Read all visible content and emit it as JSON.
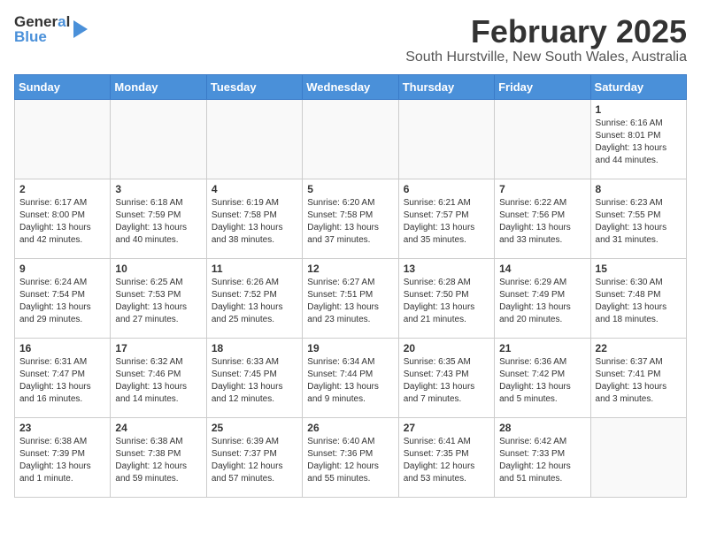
{
  "header": {
    "logo_line1_text": "General",
    "logo_line1_accent": "▶",
    "logo_line2_text": "Blue",
    "month_title": "February 2025",
    "location": "South Hurstville, New South Wales, Australia"
  },
  "calendar": {
    "day_headers": [
      "Sunday",
      "Monday",
      "Tuesday",
      "Wednesday",
      "Thursday",
      "Friday",
      "Saturday"
    ],
    "weeks": [
      {
        "days": [
          {
            "num": "",
            "info": ""
          },
          {
            "num": "",
            "info": ""
          },
          {
            "num": "",
            "info": ""
          },
          {
            "num": "",
            "info": ""
          },
          {
            "num": "",
            "info": ""
          },
          {
            "num": "",
            "info": ""
          },
          {
            "num": "1",
            "info": "Sunrise: 6:16 AM\nSunset: 8:01 PM\nDaylight: 13 hours\nand 44 minutes."
          }
        ]
      },
      {
        "days": [
          {
            "num": "2",
            "info": "Sunrise: 6:17 AM\nSunset: 8:00 PM\nDaylight: 13 hours\nand 42 minutes."
          },
          {
            "num": "3",
            "info": "Sunrise: 6:18 AM\nSunset: 7:59 PM\nDaylight: 13 hours\nand 40 minutes."
          },
          {
            "num": "4",
            "info": "Sunrise: 6:19 AM\nSunset: 7:58 PM\nDaylight: 13 hours\nand 38 minutes."
          },
          {
            "num": "5",
            "info": "Sunrise: 6:20 AM\nSunset: 7:58 PM\nDaylight: 13 hours\nand 37 minutes."
          },
          {
            "num": "6",
            "info": "Sunrise: 6:21 AM\nSunset: 7:57 PM\nDaylight: 13 hours\nand 35 minutes."
          },
          {
            "num": "7",
            "info": "Sunrise: 6:22 AM\nSunset: 7:56 PM\nDaylight: 13 hours\nand 33 minutes."
          },
          {
            "num": "8",
            "info": "Sunrise: 6:23 AM\nSunset: 7:55 PM\nDaylight: 13 hours\nand 31 minutes."
          }
        ]
      },
      {
        "days": [
          {
            "num": "9",
            "info": "Sunrise: 6:24 AM\nSunset: 7:54 PM\nDaylight: 13 hours\nand 29 minutes."
          },
          {
            "num": "10",
            "info": "Sunrise: 6:25 AM\nSunset: 7:53 PM\nDaylight: 13 hours\nand 27 minutes."
          },
          {
            "num": "11",
            "info": "Sunrise: 6:26 AM\nSunset: 7:52 PM\nDaylight: 13 hours\nand 25 minutes."
          },
          {
            "num": "12",
            "info": "Sunrise: 6:27 AM\nSunset: 7:51 PM\nDaylight: 13 hours\nand 23 minutes."
          },
          {
            "num": "13",
            "info": "Sunrise: 6:28 AM\nSunset: 7:50 PM\nDaylight: 13 hours\nand 21 minutes."
          },
          {
            "num": "14",
            "info": "Sunrise: 6:29 AM\nSunset: 7:49 PM\nDaylight: 13 hours\nand 20 minutes."
          },
          {
            "num": "15",
            "info": "Sunrise: 6:30 AM\nSunset: 7:48 PM\nDaylight: 13 hours\nand 18 minutes."
          }
        ]
      },
      {
        "days": [
          {
            "num": "16",
            "info": "Sunrise: 6:31 AM\nSunset: 7:47 PM\nDaylight: 13 hours\nand 16 minutes."
          },
          {
            "num": "17",
            "info": "Sunrise: 6:32 AM\nSunset: 7:46 PM\nDaylight: 13 hours\nand 14 minutes."
          },
          {
            "num": "18",
            "info": "Sunrise: 6:33 AM\nSunset: 7:45 PM\nDaylight: 13 hours\nand 12 minutes."
          },
          {
            "num": "19",
            "info": "Sunrise: 6:34 AM\nSunset: 7:44 PM\nDaylight: 13 hours\nand 9 minutes."
          },
          {
            "num": "20",
            "info": "Sunrise: 6:35 AM\nSunset: 7:43 PM\nDaylight: 13 hours\nand 7 minutes."
          },
          {
            "num": "21",
            "info": "Sunrise: 6:36 AM\nSunset: 7:42 PM\nDaylight: 13 hours\nand 5 minutes."
          },
          {
            "num": "22",
            "info": "Sunrise: 6:37 AM\nSunset: 7:41 PM\nDaylight: 13 hours\nand 3 minutes."
          }
        ]
      },
      {
        "days": [
          {
            "num": "23",
            "info": "Sunrise: 6:38 AM\nSunset: 7:39 PM\nDaylight: 13 hours\nand 1 minute."
          },
          {
            "num": "24",
            "info": "Sunrise: 6:38 AM\nSunset: 7:38 PM\nDaylight: 12 hours\nand 59 minutes."
          },
          {
            "num": "25",
            "info": "Sunrise: 6:39 AM\nSunset: 7:37 PM\nDaylight: 12 hours\nand 57 minutes."
          },
          {
            "num": "26",
            "info": "Sunrise: 6:40 AM\nSunset: 7:36 PM\nDaylight: 12 hours\nand 55 minutes."
          },
          {
            "num": "27",
            "info": "Sunrise: 6:41 AM\nSunset: 7:35 PM\nDaylight: 12 hours\nand 53 minutes."
          },
          {
            "num": "28",
            "info": "Sunrise: 6:42 AM\nSunset: 7:33 PM\nDaylight: 12 hours\nand 51 minutes."
          },
          {
            "num": "",
            "info": ""
          }
        ]
      }
    ]
  }
}
